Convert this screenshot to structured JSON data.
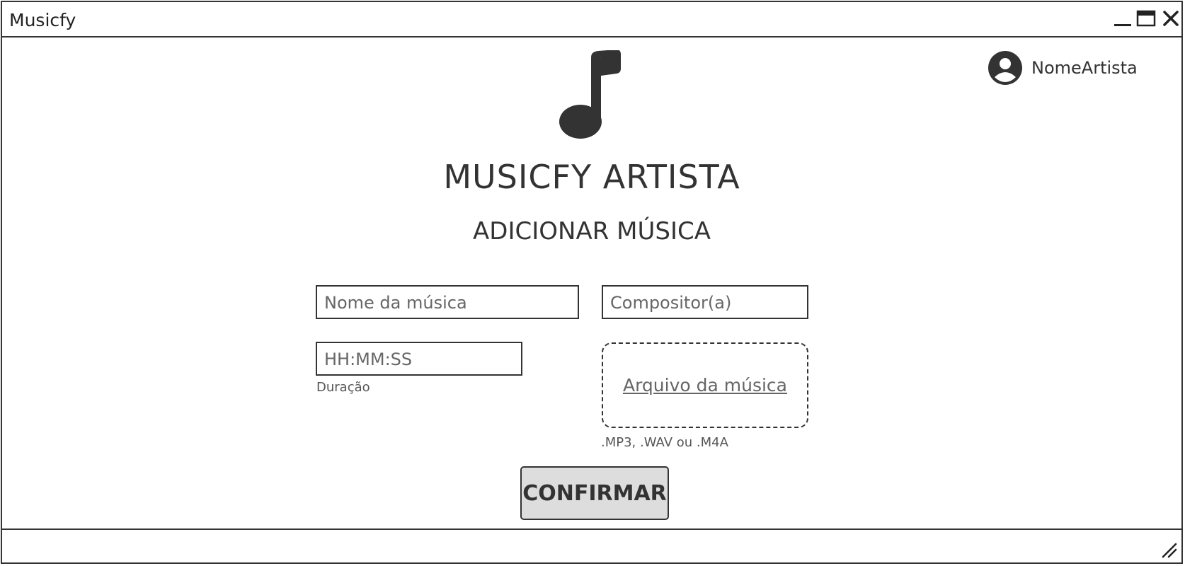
{
  "window": {
    "title": "Musicfy"
  },
  "user": {
    "name": "NomeArtista"
  },
  "header": {
    "brand": "MUSICFY ARTISTA",
    "subtitle": "ADICIONAR MÚSICA"
  },
  "form": {
    "song_name_placeholder": "Nome da música",
    "composer_placeholder": "Compositor(a)",
    "duration_placeholder": "HH:MM:SS",
    "duration_label": "Duração",
    "file_link": "Arquivo da música",
    "file_formats": ".MP3, .WAV ou .M4A",
    "confirm_label": "CONFIRMAR"
  },
  "icons": {
    "logo": "music-note-icon",
    "user": "user-circle-icon",
    "minimize": "minimize-icon",
    "maximize": "maximize-icon",
    "close": "close-icon",
    "resize": "resize-grip-icon"
  },
  "colors": {
    "ink": "#333333",
    "button_bg": "#dddddd"
  }
}
